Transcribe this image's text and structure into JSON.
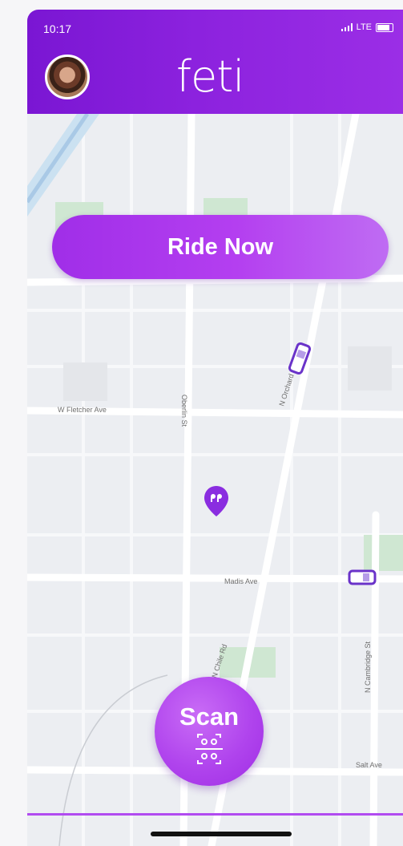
{
  "status_bar": {
    "time": "10:17",
    "network": "LTE"
  },
  "header": {
    "logo_text": "feti"
  },
  "actions": {
    "ride_now": "Ride Now",
    "scan": "Scan"
  },
  "map": {
    "streets": [
      "W Fletcher Ave",
      "Oberlin St",
      "N Orchard Rd",
      "Madis Ave",
      "N Cambridge St",
      "N Chile Rd",
      "Salt Ave"
    ]
  },
  "colors": {
    "brand": "#8c22de",
    "accent": "#b44af0"
  }
}
